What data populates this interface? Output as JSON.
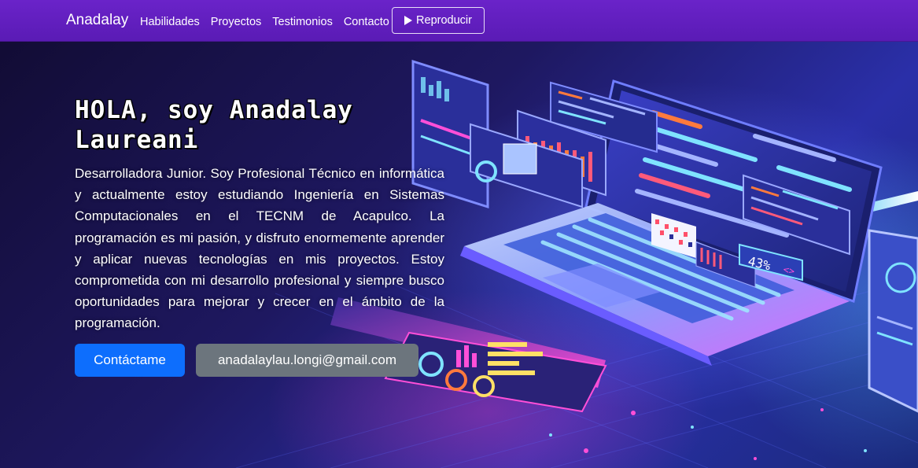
{
  "navbar": {
    "brand": "Anadalay",
    "links": [
      "Habilidades",
      "Proyectos",
      "Testimonios",
      "Contacto"
    ],
    "play_button": "Reproducir"
  },
  "hero": {
    "title": "HOLA, soy Anadalay Laureani",
    "description": "Desarrolladora Junior. Soy Profesional Técnico en informática y actualmente estoy estudiando Ingeniería en Sistemas Computacionales en el TECNM de Acapulco. La programación es mi pasión, y disfruto enormemente aprender y aplicar nuevas tecnologías en mis proyectos. Estoy comprometida con mi desarrollo profesional y siempre busco oportunidades para mejorar y crecer en el ámbito de la programación.",
    "contact_button": "Contáctame",
    "email_button": "anadalaylau.longi@gmail.com"
  },
  "illustration": {
    "percent_label": "43%",
    "code_glyph": "<>",
    "colors": {
      "accent_cyan": "#7fe3ff",
      "accent_pink": "#ff4fd8",
      "accent_orange": "#ff7a3d",
      "accent_yellow": "#ffe066"
    }
  },
  "colors": {
    "navbar": "#5e1fbd",
    "primary_button": "#0d6efd",
    "secondary_button": "#6c757d"
  }
}
